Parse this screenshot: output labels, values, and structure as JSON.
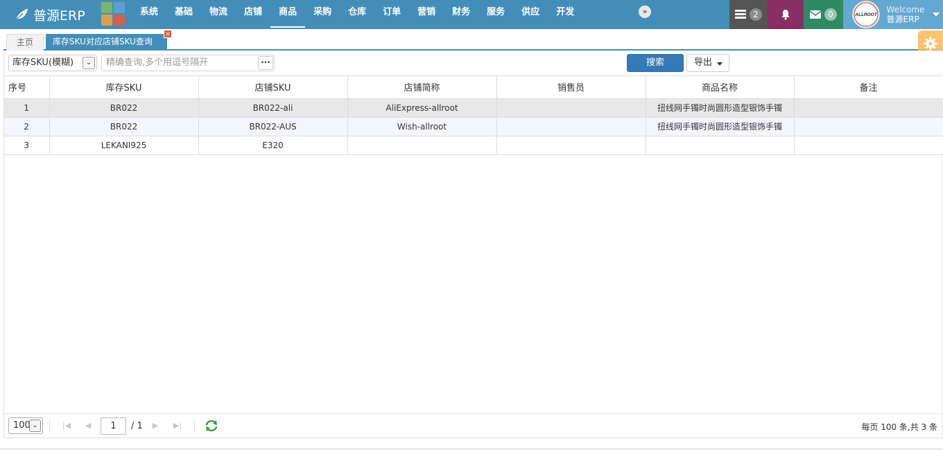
{
  "brand": {
    "name": "普源ERP"
  },
  "nav": {
    "items": [
      {
        "label": "系统",
        "active": false
      },
      {
        "label": "基础",
        "active": false
      },
      {
        "label": "物流",
        "active": false
      },
      {
        "label": "店铺",
        "active": false
      },
      {
        "label": "商品",
        "active": true
      },
      {
        "label": "采购",
        "active": false
      },
      {
        "label": "仓库",
        "active": false
      },
      {
        "label": "订单",
        "active": false
      },
      {
        "label": "营销",
        "active": false
      },
      {
        "label": "财务",
        "active": false
      },
      {
        "label": "服务",
        "active": false
      },
      {
        "label": "供应",
        "active": false
      },
      {
        "label": "开发",
        "active": false
      }
    ],
    "more_icon": "double-chevron-right-icon"
  },
  "tools": {
    "tasks_count": "2",
    "mail_count": "0"
  },
  "user": {
    "welcome": "Welcome",
    "name": "普源ERP",
    "avatar_text": "ALLROOT"
  },
  "tabs": {
    "home": "主页",
    "active": "库存SKU对应店铺SKU查询",
    "close": "×"
  },
  "toolbar": {
    "search_field": "库存SKU(模糊)",
    "search_placeholder": "精确查询,多个用逗号隔开",
    "dots": "···",
    "search_button": "搜索",
    "export_button": "导出"
  },
  "table": {
    "columns": [
      "序号",
      "库存SKU",
      "店铺SKU",
      "店铺简称",
      "销售员",
      "商品名称",
      "备注"
    ],
    "rows": [
      [
        "1",
        "BR022",
        "BR022-ali",
        "AliExpress-allroot",
        "",
        "扭线网手镯时尚圆形造型银饰手镯",
        ""
      ],
      [
        "2",
        "BR022",
        "BR022-AUS",
        "Wish-allroot",
        "",
        "扭线网手镯时尚圆形造型银饰手镯",
        ""
      ],
      [
        "3",
        "LEKANI925",
        "E320",
        "",
        "",
        "",
        ""
      ]
    ]
  },
  "pager": {
    "page_size": "100",
    "current_page": "1",
    "total_pages": "/ 1",
    "info": "每页 100 条,共 3 条"
  },
  "colors": {
    "nav_bg": "#438eb9",
    "tasks_bg": "#555555",
    "notify_bg": "#892e65",
    "mail_bg": "#2e8965",
    "user_bg": "#62a8d1",
    "primary_button": "#337ab7",
    "settings_bg": "#ffb752"
  }
}
